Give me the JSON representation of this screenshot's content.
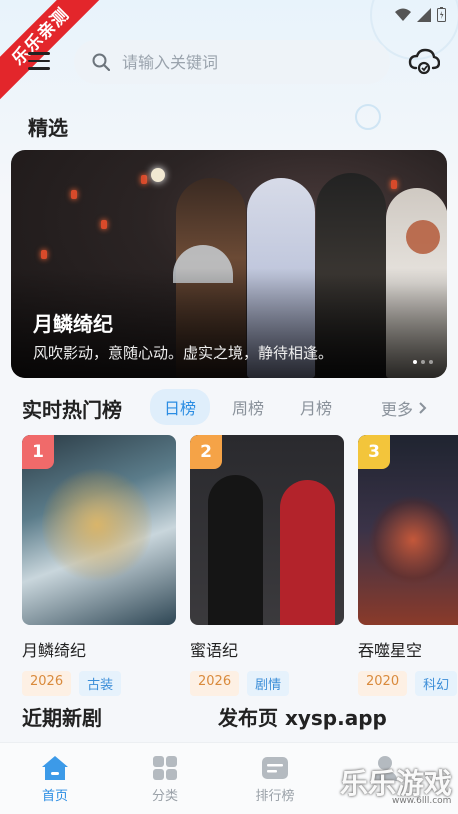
{
  "status": {
    "time": ""
  },
  "ribbon": "乐乐亲测",
  "search": {
    "placeholder": "请输入关键词"
  },
  "featured": {
    "heading": "精选",
    "banner": {
      "title": "月鳞绮纪",
      "desc": "风吹影动，意随心动。虚实之境，静待相逢。"
    }
  },
  "hot": {
    "heading": "实时热门榜",
    "tabs": [
      "日榜",
      "周榜",
      "月榜"
    ],
    "more": "更多",
    "items": [
      {
        "rank": "1",
        "title": "月鳞绮纪",
        "year": "2026",
        "genre": "古装",
        "badge_color": "#f06a6a"
      },
      {
        "rank": "2",
        "title": "蜜语纪",
        "year": "2026",
        "genre": "剧情",
        "badge_color": "#f5a347"
      },
      {
        "rank": "3",
        "title": "吞噬星空",
        "year": "2020",
        "genre": "科幻",
        "badge_color": "#f3c53b"
      }
    ]
  },
  "recent": {
    "heading": "近期新剧",
    "publish": "发布页 xysp.app"
  },
  "nav": [
    {
      "label": "首页",
      "icon": "home-icon"
    },
    {
      "label": "分类",
      "icon": "grid-icon"
    },
    {
      "label": "排行榜",
      "icon": "ranking-icon"
    },
    {
      "label": "",
      "icon": "user-icon"
    }
  ],
  "watermark": {
    "text": "乐乐游戏",
    "url": "www.6lll.com"
  },
  "colors": {
    "accent": "#2b8de3",
    "ribbon": "#e3262b",
    "background": "#f5f7fa"
  }
}
